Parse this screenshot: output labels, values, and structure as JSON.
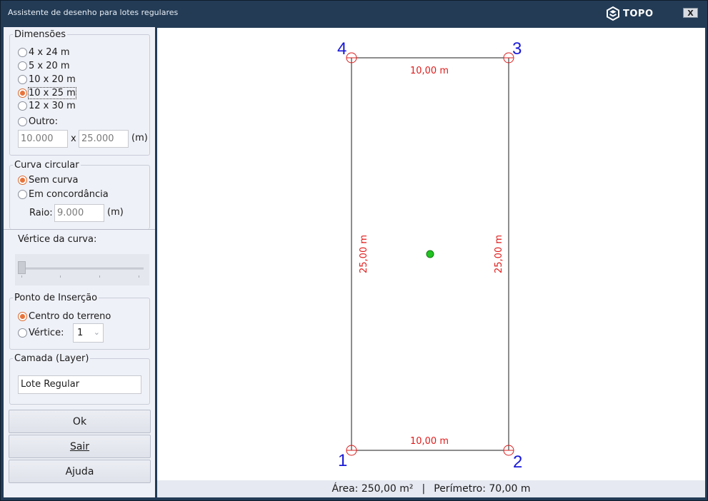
{
  "window": {
    "title": "Assistente de desenho para lotes regulares",
    "logo_text": "TOPO",
    "close_label": "X"
  },
  "dimensions": {
    "legend": "Dimensões",
    "options": [
      "4 x 24 m",
      "5 x 20 m",
      "10 x 20 m",
      "10 x 25 m",
      "12 x 30 m"
    ],
    "selected": "10 x 25 m",
    "other_label": "Outro:",
    "width_value": "10.000",
    "times": "x",
    "length_value": "25.000",
    "unit": "(m)"
  },
  "curve": {
    "legend": "Curva circular",
    "no_curve_label": "Sem curva",
    "concordance_label": "Em concordância",
    "radius_label": "Raio:",
    "radius_value": "9.000",
    "unit": "(m)",
    "vertex_label": "Vértice da curva:",
    "slider_value": 0
  },
  "insertion": {
    "legend": "Ponto de Inserção",
    "center_label": "Centro do terreno",
    "vertex_label": "Vértice:",
    "vertex_value": "1"
  },
  "layer": {
    "legend": "Camada (Layer)",
    "value": "Lote Regular"
  },
  "buttons": {
    "ok": "Ok",
    "exit": "Sair",
    "help": "Ajuda"
  },
  "drawing": {
    "vertices": [
      "1",
      "2",
      "3",
      "4"
    ],
    "top_dim": "10,00 m",
    "bottom_dim": "10,00 m",
    "left_dim": "25,00 m",
    "right_dim": "25,00 m",
    "dim_color": "#e01b1b",
    "vertex_color": "#1a1ad8",
    "center_color": "#22c322"
  },
  "status": {
    "area": "Área: 250,00 m²",
    "separator": "|",
    "perimeter": "Perímetro: 70,00 m"
  }
}
